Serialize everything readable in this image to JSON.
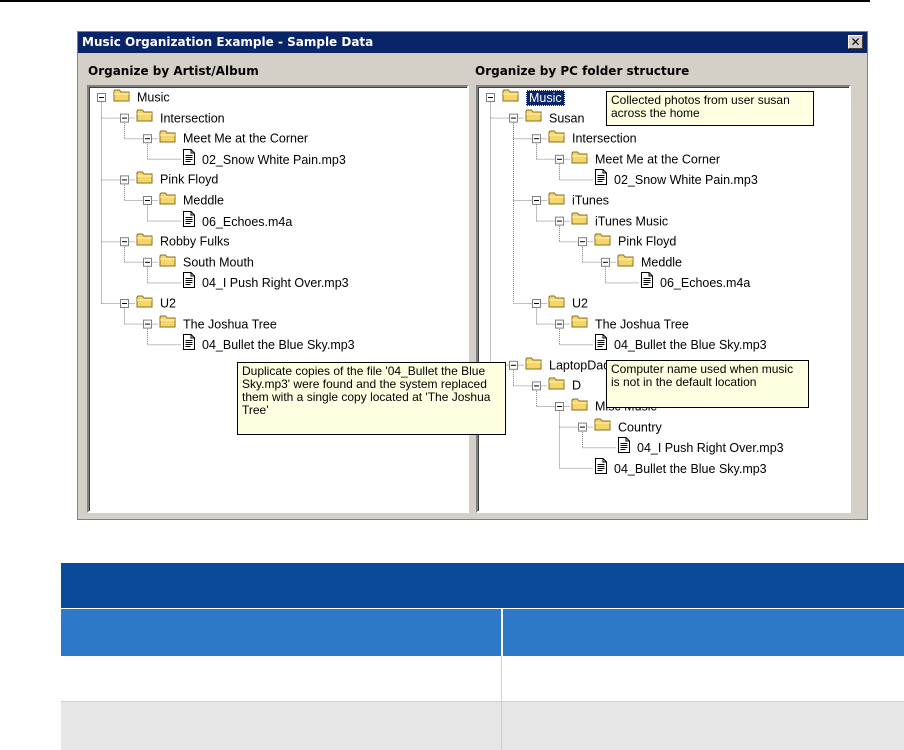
{
  "window": {
    "title": "Music Organization Example - Sample Data",
    "close_label": "✕"
  },
  "left_pane": {
    "label": "Organize by Artist/Album",
    "tree": [
      {
        "depth": 0,
        "type": "folder",
        "label": "Music"
      },
      {
        "depth": 1,
        "type": "folder",
        "label": "Intersection"
      },
      {
        "depth": 2,
        "type": "folder",
        "label": "Meet Me at the Corner"
      },
      {
        "depth": 3,
        "type": "file",
        "label": "02_Snow White Pain.mp3"
      },
      {
        "depth": 1,
        "type": "folder",
        "label": "Pink Floyd"
      },
      {
        "depth": 2,
        "type": "folder",
        "label": "Meddle"
      },
      {
        "depth": 3,
        "type": "file",
        "label": "06_Echoes.m4a"
      },
      {
        "depth": 1,
        "type": "folder",
        "label": "Robby Fulks"
      },
      {
        "depth": 2,
        "type": "folder",
        "label": "South Mouth"
      },
      {
        "depth": 3,
        "type": "file",
        "label": "04_I Push Right Over.mp3"
      },
      {
        "depth": 1,
        "type": "folder",
        "label": "U2"
      },
      {
        "depth": 2,
        "type": "folder",
        "label": "The Joshua Tree"
      },
      {
        "depth": 3,
        "type": "file",
        "label": "04_Bullet the Blue Sky.mp3"
      }
    ],
    "tooltip": "Duplicate copies of the file '04_Bullet the Blue Sky.mp3' were found and the system replaced them with a single copy located at 'The Joshua Tree'"
  },
  "right_pane": {
    "label": "Organize by PC folder structure",
    "tree": [
      {
        "depth": 0,
        "type": "folder",
        "label": "Music",
        "selected": true
      },
      {
        "depth": 1,
        "type": "folder",
        "label": "Susan"
      },
      {
        "depth": 2,
        "type": "folder",
        "label": "Intersection"
      },
      {
        "depth": 3,
        "type": "folder",
        "label": "Meet Me at the Corner"
      },
      {
        "depth": 4,
        "type": "file",
        "label": "02_Snow White Pain.mp3"
      },
      {
        "depth": 2,
        "type": "folder",
        "label": "iTunes"
      },
      {
        "depth": 3,
        "type": "folder",
        "label": "iTunes Music"
      },
      {
        "depth": 4,
        "type": "folder",
        "label": "Pink Floyd"
      },
      {
        "depth": 5,
        "type": "folder",
        "label": "Meddle"
      },
      {
        "depth": 6,
        "type": "file",
        "label": "06_Echoes.m4a"
      },
      {
        "depth": 2,
        "type": "folder",
        "label": "U2"
      },
      {
        "depth": 3,
        "type": "folder",
        "label": "The Joshua Tree"
      },
      {
        "depth": 4,
        "type": "file",
        "label": "04_Bullet the Blue Sky.mp3"
      },
      {
        "depth": 1,
        "type": "folder",
        "label": "LaptopDad"
      },
      {
        "depth": 2,
        "type": "folder",
        "label": "D"
      },
      {
        "depth": 3,
        "type": "folder",
        "label": "Misc Music"
      },
      {
        "depth": 4,
        "type": "folder",
        "label": "Country"
      },
      {
        "depth": 5,
        "type": "file",
        "label": "04_I Push Right Over.mp3"
      },
      {
        "depth": 4,
        "type": "file",
        "label": "04_Bullet the Blue Sky.mp3"
      }
    ],
    "tooltip_user": "Collected photos from user susan across the home",
    "tooltip_computer": "Computer name used when music is not in the default location"
  },
  "colors": {
    "titlebar": "#0a246a",
    "table_header": "#0a4a9a",
    "table_subheader": "#2e79c7",
    "table_row_alt": "#e6e6e6",
    "folder": "#f5d66b",
    "tooltip_bg": "#ffffe1"
  },
  "icons": {
    "folder": "folder-icon",
    "file": "file-icon",
    "expander": "collapse-box-icon",
    "close": "close-icon"
  }
}
